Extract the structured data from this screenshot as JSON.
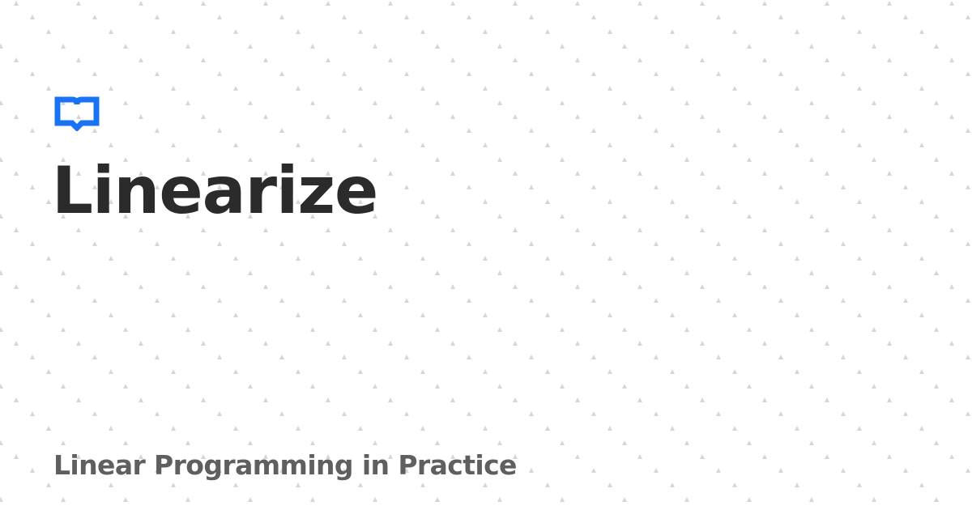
{
  "brand": {
    "title": "Linearize",
    "subtitle": "Linear Programming in Practice",
    "icon": "open-book-icon"
  },
  "colors": {
    "background": "#ffffff",
    "accent": "#1a73f5",
    "title": "#2b2b2b",
    "subtitle": "#5f5f5f",
    "pattern": "#d6d6d6"
  }
}
